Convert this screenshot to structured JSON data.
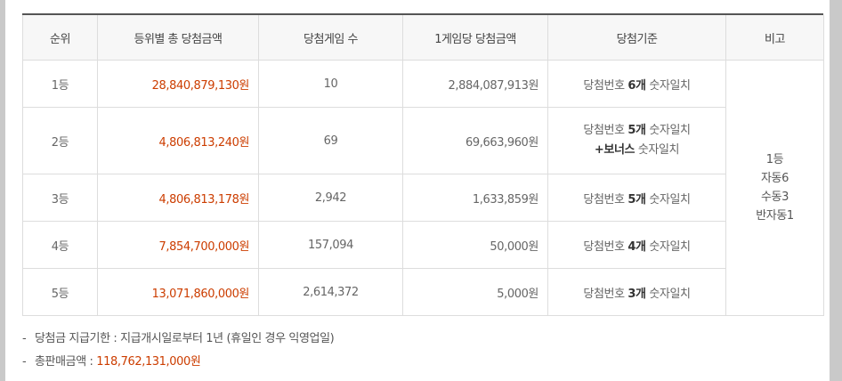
{
  "headers": [
    "순위",
    "등위별 총 당첨금액",
    "당첨게임 수",
    "1게임당 당첨금액",
    "당첨기준",
    "비고"
  ],
  "rows": [
    {
      "rank": "1등",
      "total": "28,840,879,130원",
      "games": "10",
      "per_game": "2,884,087,913원",
      "criteria_pre": "당첨번호 ",
      "criteria_bold": "6개",
      "criteria_post": " 숫자일치"
    },
    {
      "rank": "2등",
      "total": "4,806,813,240원",
      "games": "69",
      "per_game": "69,663,960원",
      "criteria_pre": "당첨번호 ",
      "criteria_bold": "5개",
      "criteria_post": " 숫자일치",
      "criteria2_pre": "+",
      "criteria2_bold": "보너스",
      "criteria2_post": " 숫자일치"
    },
    {
      "rank": "3등",
      "total": "4,806,813,178원",
      "games": "2,942",
      "per_game": "1,633,859원",
      "criteria_pre": "당첨번호 ",
      "criteria_bold": "5개",
      "criteria_post": " 숫자일치"
    },
    {
      "rank": "4등",
      "total": "7,854,700,000원",
      "games": "157,094",
      "per_game": "50,000원",
      "criteria_pre": "당첨번호 ",
      "criteria_bold": "4개",
      "criteria_post": " 숫자일치"
    },
    {
      "rank": "5등",
      "total": "13,071,860,000원",
      "games": "2,614,372",
      "per_game": "5,000원",
      "criteria_pre": "당첨번호 ",
      "criteria_bold": "3개",
      "criteria_post": " 숫자일치"
    }
  ],
  "remark": [
    "1등",
    "자동6",
    "수동3",
    "반자동1"
  ],
  "notes": {
    "deadline": "당첨금 지급기한 : 지급개시일로부터 1년 (휴일인 경우 익영업일)",
    "sales_label": "총판매금액 : ",
    "sales_amount": "118,762,131,000원"
  },
  "colors": {
    "accent": "#cc3d00",
    "header_bg": "#f7f7f7",
    "border": "#dddddd"
  }
}
